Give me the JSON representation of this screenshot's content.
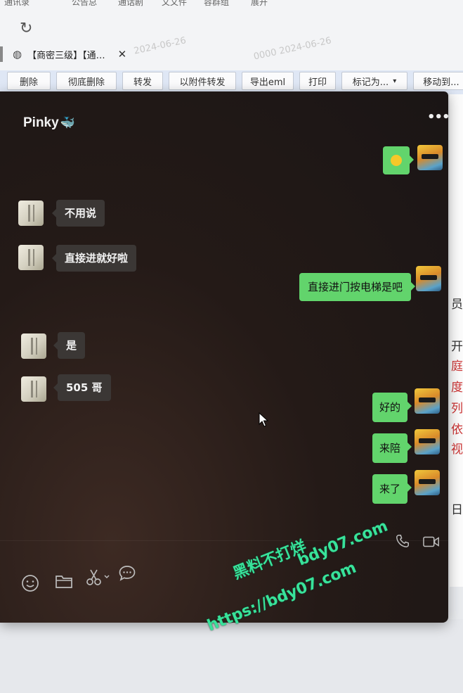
{
  "background": {
    "top_nav": [
      "通讯录",
      "公告总",
      "通话剧",
      "文文件",
      "容群组",
      "展开"
    ],
    "tab_title": "【商密三级】【通…",
    "watermark_dates": [
      "2024-06-26",
      "0000 2024-06-26"
    ],
    "toolbar_buttons": [
      "删除",
      "彻底删除",
      "转发",
      "以附件转发",
      "导出eml",
      "打印",
      "标记为...",
      "移动到..."
    ],
    "right_peek_chars": [
      "员.",
      "开",
      "庭",
      "度",
      "列",
      "依",
      "视",
      "日"
    ]
  },
  "chat": {
    "title": "Pinky",
    "title_emoji": "🐳",
    "messages": [
      {
        "from": "me",
        "text": "😮"
      },
      {
        "from": "them",
        "text": "不用说"
      },
      {
        "from": "them",
        "text": "直接进就好啦"
      },
      {
        "from": "me",
        "text": "直接进门按电梯是吧"
      },
      {
        "from": "them",
        "text": "是"
      },
      {
        "from": "them",
        "text": "505 哥"
      },
      {
        "from": "me",
        "text": "好的"
      },
      {
        "from": "me",
        "text": "来陪"
      },
      {
        "from": "me",
        "text": "来了"
      }
    ],
    "toolbar_icons": [
      "emoji-icon",
      "folder-icon",
      "scissors-icon",
      "chat-bubble-icon"
    ],
    "call_icons": [
      "phone-icon",
      "video-icon"
    ]
  },
  "overlay_watermark": {
    "line1": "黑料不打烊",
    "line2": "bdy07.com",
    "line3": "https://bdy07.com"
  }
}
